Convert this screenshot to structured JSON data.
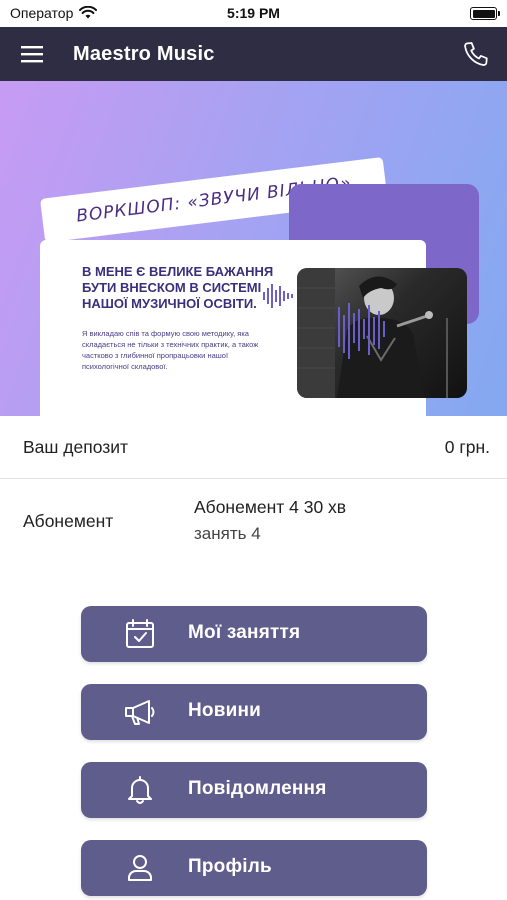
{
  "status_bar": {
    "carrier": "Оператор",
    "time": "5:19 PM"
  },
  "app_bar": {
    "title": "Maestro Music"
  },
  "banner": {
    "tag": "ВОРКШОП: «ЗВУЧИ ВІЛЬНО»",
    "headline": "В МЕНЕ Є ВЕЛИКЕ БАЖАННЯ БУТИ ВНЕСКОМ В СИСТЕМІ НАШОЇ МУЗИЧНОЇ ОСВІТИ.",
    "body": "Я викладаю спів та формую свою методику, яка складається не тільки з технічних практик, а також частково з глибинної пропрацьовки нашої психологічної складової."
  },
  "deposit": {
    "label": "Ваш депозит",
    "value": "0 грн."
  },
  "subscription": {
    "label": "Абонемент",
    "name": "Абонемент 4 30 хв",
    "lessons": "занять 4"
  },
  "menu": [
    {
      "label": "Мої заняття",
      "icon": "calendar-check-icon"
    },
    {
      "label": "Новини",
      "icon": "megaphone-icon"
    },
    {
      "label": "Повідомлення",
      "icon": "bell-icon"
    },
    {
      "label": "Профіль",
      "icon": "user-icon"
    }
  ],
  "colors": {
    "app_bar": "#2f2d44",
    "button": "#5f5d8c",
    "banner_start": "#c79bf3",
    "banner_end": "#83a9f1"
  }
}
